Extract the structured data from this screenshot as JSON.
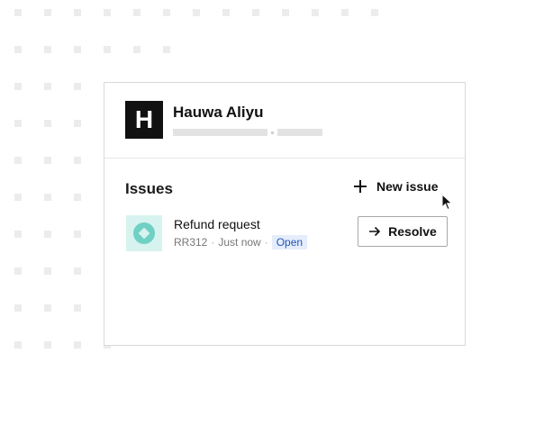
{
  "profile": {
    "avatar_letter": "H",
    "name": "Hauwa Aliyu"
  },
  "issues": {
    "title": "Issues",
    "new_issue_label": "New issue",
    "items": [
      {
        "name": "Refund request",
        "id": "RR312",
        "time": "Just now",
        "status": "Open",
        "action_label": "Resolve"
      }
    ]
  },
  "colors": {
    "avatar_bg": "#111111",
    "issue_icon_bg": "#d7f3ef",
    "issue_icon_fg": "#6fd0c4",
    "status_badge_bg": "#e5edfb",
    "status_badge_fg": "#2456b8"
  },
  "icons": {
    "new_issue": "plus-icon",
    "issue": "ticket-icon",
    "resolve": "arrow-right-icon",
    "pointer": "mouse-cursor-icon"
  }
}
